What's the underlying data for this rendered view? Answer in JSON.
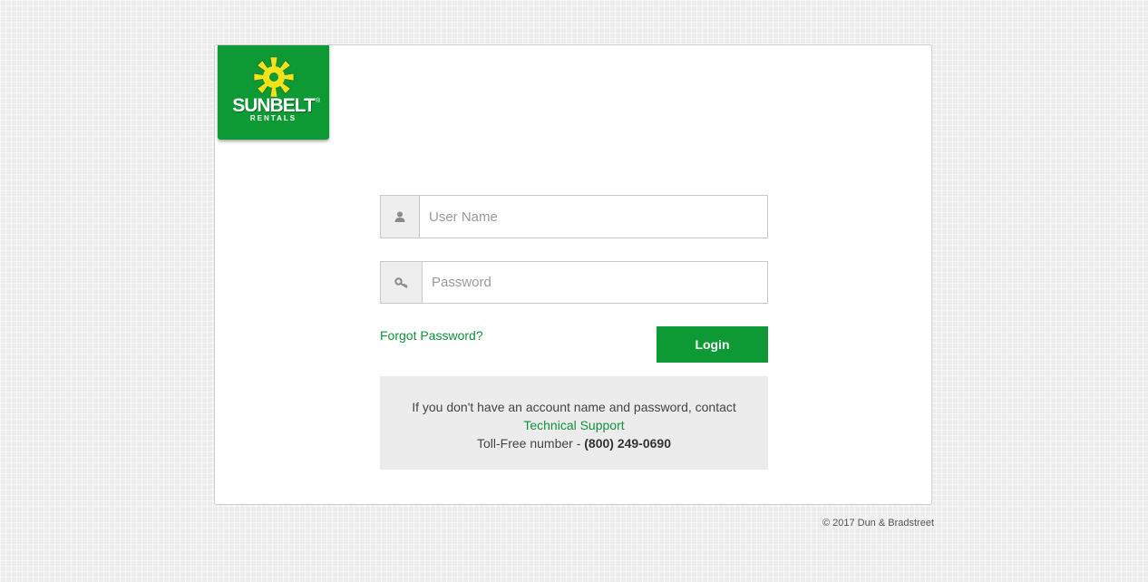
{
  "brand": {
    "name": "SUNBELT",
    "sub": "RENTALS",
    "registered": "®",
    "color": "#0d9a35",
    "sun_color": "#f5e11a"
  },
  "form": {
    "username": {
      "placeholder": "User Name",
      "value": "",
      "icon": "user-icon"
    },
    "password": {
      "placeholder": "Password",
      "value": "",
      "icon": "key-icon"
    },
    "forgot_label": "Forgot Password?",
    "login_label": "Login"
  },
  "info": {
    "line1": "If you don't have an account name and password, contact",
    "link": "Technical Support",
    "toll_label": "Toll-Free number - ",
    "toll_number": "(800) 249-0690"
  },
  "footer": {
    "copyright": "© 2017 Dun & Bradstreet"
  },
  "colors": {
    "accent": "#0d9a35",
    "link": "#11923a",
    "info_bg": "#ececec"
  }
}
